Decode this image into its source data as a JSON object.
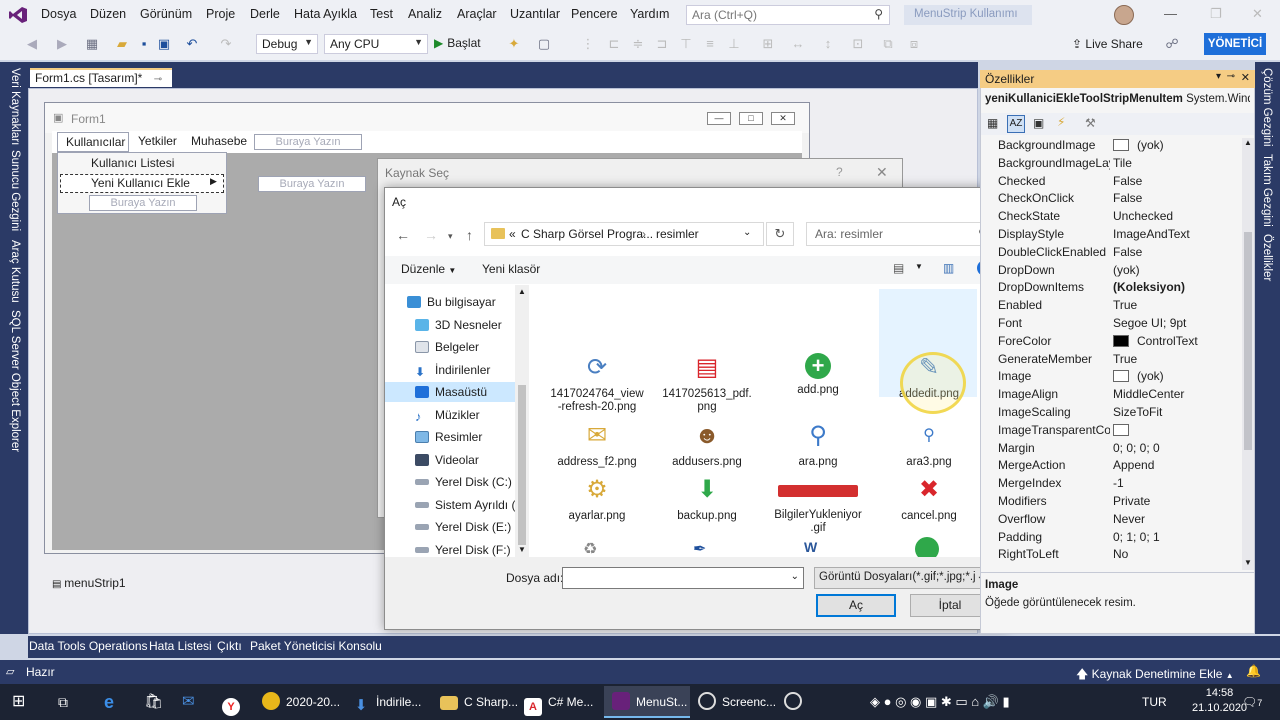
{
  "menubar": {
    "items": [
      "Dosya",
      "Düzen",
      "Görünüm",
      "Proje",
      "Derle",
      "Hata Ayıkla",
      "Test",
      "Analiz",
      "Araçlar",
      "Uzantılar",
      "Pencere",
      "Yardım"
    ],
    "search_placeholder": "Ara (Ctrl+Q)",
    "solution_title": "MenuStrip Kullanımı"
  },
  "toolbar": {
    "config": "Debug",
    "platform": "Any CPU",
    "start_label": "Başlat",
    "live_share": "Live Share",
    "admin_badge": "YÖNETİCİ"
  },
  "left_strip": [
    "Veri Kaynakları",
    "Sunucu Gezgini",
    "Araç Kutusu",
    "SQL Server Object Explorer"
  ],
  "right_strip": [
    "Çözüm Gezgini",
    "Takım Gezgini",
    "Özellikler"
  ],
  "doc_tab": "Form1.cs [Tasarım]*",
  "form": {
    "title": "Form1",
    "menu": [
      "Kullanıcılar",
      "Yetkiler",
      "Muhasebe"
    ],
    "type_here": "Buraya Yazın",
    "dropdown": [
      "Kullanıcı Listesi",
      "Yeni Kullanıcı Ekle"
    ],
    "tray_component": "menuStrip1"
  },
  "kaynak_dialog": {
    "title": "Kaynak Seç"
  },
  "open_dialog": {
    "title": "Aç",
    "address": {
      "root": "«",
      "parent": "C Sharp Görsel Progra...",
      "current": "resimler"
    },
    "search_placeholder": "Ara: resimler",
    "organize": "Düzenle",
    "new_folder": "Yeni klasör",
    "tree": [
      "Bu bilgisayar",
      "3D Nesneler",
      "Belgeler",
      "İndirilenler",
      "Masaüstü",
      "Müzikler",
      "Resimler",
      "Videolar",
      "Yerel Disk (C:)",
      "Sistem Ayrıldı (D",
      "Yerel Disk (E:)",
      "Yerel Disk (F:)"
    ],
    "files": [
      {
        "name": "1417024764_view\n-refresh-20.png",
        "icon": "refresh-icon"
      },
      {
        "name": "1417025613_pdf.\npng",
        "icon": "pdf-icon"
      },
      {
        "name": "add.png",
        "icon": "add-icon"
      },
      {
        "name": "addedit.png",
        "icon": "edit-icon"
      },
      {
        "name": "address_f2.png",
        "icon": "address-icon"
      },
      {
        "name": "addusers.png",
        "icon": "users-icon"
      },
      {
        "name": "ara.png",
        "icon": "magnifier-icon"
      },
      {
        "name": "ara3.png",
        "icon": "magnifier-small-icon"
      },
      {
        "name": "ayarlar.png",
        "icon": "settings-icon"
      },
      {
        "name": "backup.png",
        "icon": "backup-icon"
      },
      {
        "name": "BilgilerYukleniyor\n.gif",
        "icon": "loading-bar-icon"
      },
      {
        "name": "cancel.png",
        "icon": "cancel-icon"
      }
    ],
    "file_name_label": "Dosya adı:",
    "file_name_value": "",
    "file_type": "Görüntü Dosyaları(*.gif;*.jpg;*.j",
    "open_button": "Aç",
    "cancel_button": "İptal"
  },
  "properties": {
    "title": "Özellikler",
    "object": "yeniKullaniciEkleToolStripMenuItem",
    "object_type": "System.Windows.Forms.ToolStripMenuItem",
    "rows": [
      {
        "name": "BackgroundImage",
        "value": "(yok)"
      },
      {
        "name": "BackgroundImageLayout",
        "value": "Tile"
      },
      {
        "name": "Checked",
        "value": "False"
      },
      {
        "name": "CheckOnClick",
        "value": "False"
      },
      {
        "name": "CheckState",
        "value": "Unchecked"
      },
      {
        "name": "DisplayStyle",
        "value": "ImageAndText"
      },
      {
        "name": "DoubleClickEnabled",
        "value": "False"
      },
      {
        "name": "DropDown",
        "value": "(yok)"
      },
      {
        "name": "DropDownItems",
        "value": "(Koleksiyon)"
      },
      {
        "name": "Enabled",
        "value": "True"
      },
      {
        "name": "Font",
        "value": "Segoe UI; 9pt"
      },
      {
        "name": "ForeColor",
        "value": "ControlText"
      },
      {
        "name": "GenerateMember",
        "value": "True"
      },
      {
        "name": "Image",
        "value": "(yok)"
      },
      {
        "name": "ImageAlign",
        "value": "MiddleCenter"
      },
      {
        "name": "ImageScaling",
        "value": "SizeToFit"
      },
      {
        "name": "ImageTransparentColor",
        "value": ""
      },
      {
        "name": "Margin",
        "value": "0; 0; 0; 0"
      },
      {
        "name": "MergeAction",
        "value": "Append"
      },
      {
        "name": "MergeIndex",
        "value": "-1"
      },
      {
        "name": "Modifiers",
        "value": "Private"
      },
      {
        "name": "Overflow",
        "value": "Never"
      },
      {
        "name": "Padding",
        "value": "0; 1; 0; 1"
      },
      {
        "name": "RightToLeft",
        "value": "No"
      }
    ],
    "desc_title": "Image",
    "desc_text": "Öğede görüntülenecek resim."
  },
  "bottom_tabs": [
    "Data Tools Operations",
    "Hata Listesi",
    "Çıktı",
    "Paket Yöneticisi Konsolu"
  ],
  "status": {
    "left": "Hazır",
    "right": "Kaynak Denetimine Ekle"
  },
  "taskbar": {
    "apps": [
      "2020-20...",
      "İndirile...",
      "C Sharp...",
      "C# Me...",
      "MenuSt...",
      "Screenc..."
    ],
    "lang": "TUR",
    "time": "14:58",
    "date": "21.10.2020",
    "notif_count": "7"
  },
  "colors": {
    "accent": "#2b3a66",
    "admin": "#1e6fd9",
    "tab_highlight": "#f5cc84"
  }
}
